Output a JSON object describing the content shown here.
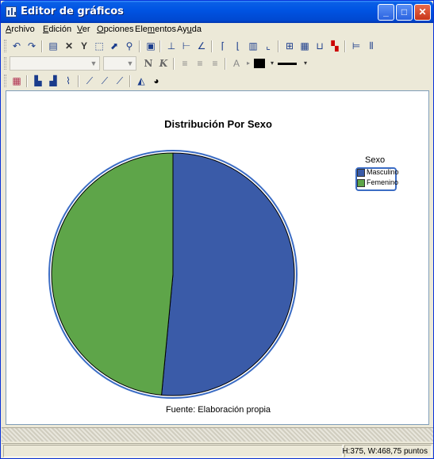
{
  "window": {
    "title": "Editor de gráficos"
  },
  "menu": [
    {
      "label": "Archivo",
      "u": "A",
      "rest": "rchivo"
    },
    {
      "label": "Edición",
      "u": "E",
      "rest": "dición"
    },
    {
      "label": "Ver",
      "u": "V",
      "rest": "er"
    },
    {
      "label": "Opciones",
      "u": "O",
      "rest": "pciones"
    },
    {
      "label": "Elementos",
      "pre": "Ele",
      "u": "m",
      "rest": "entos"
    },
    {
      "label": "Ayuda",
      "pre": "Ay",
      "u": "u",
      "rest": "da"
    }
  ],
  "format_toolbar": {
    "bold_label": "N",
    "italic_label": "K",
    "font_color_label": "A"
  },
  "chart_data": {
    "type": "pie",
    "title": "Distribución Por Sexo",
    "legend_title": "Sexo",
    "legend_position": "top-right",
    "categories": [
      "Masculino",
      "Femenino"
    ],
    "values": [
      51.5,
      48.5
    ],
    "colors": [
      "#3a5ba8",
      "#5ea549"
    ],
    "footnote": "Fuente: Elaboración propia"
  },
  "status": {
    "size_text": "H:375, W:468,75 puntos"
  }
}
